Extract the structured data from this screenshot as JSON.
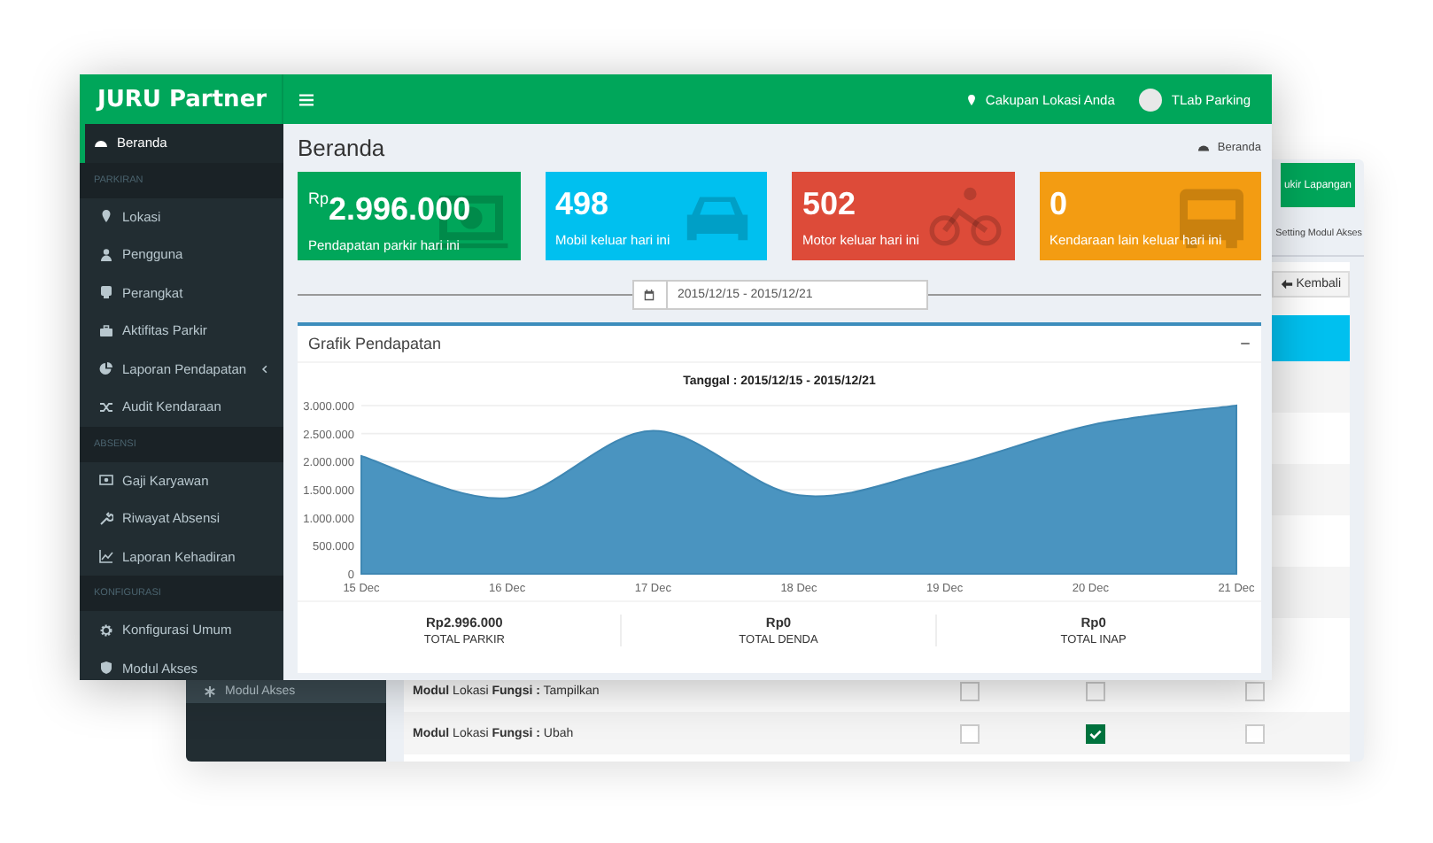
{
  "back_window": {
    "header_button": "ukir Lapangan",
    "breadcrumb": "Setting Modul Akses",
    "back_button": "Kembali",
    "sidebar_item": {
      "label": "Modul Akses",
      "selected": true
    },
    "permission_rows": [
      {
        "label": "**Modul** Lokasi **Fungsi :** Tampilkan",
        "checks": [
          {
            "checked": false
          },
          {
            "checked": false
          },
          {
            "checked": false
          }
        ]
      },
      {
        "label": "**Modul** Lokasi **Fungsi :** Ubah",
        "checks": [
          {
            "checked": false
          },
          {
            "checked": true
          },
          {
            "checked": false
          }
        ]
      }
    ]
  },
  "front_window": {
    "brand": "JURU Partner",
    "header": {
      "location": "Cakupan Lokasi Anda",
      "user": "TLab Parking"
    },
    "sidebar": [
      {
        "kind": "item",
        "label": "Beranda",
        "selected": true
      },
      {
        "kind": "header",
        "label": "PARKIRAN"
      },
      {
        "kind": "item",
        "label": "Lokasi",
        "selected": false
      },
      {
        "kind": "item",
        "label": "Pengguna",
        "selected": false
      },
      {
        "kind": "item",
        "label": "Perangkat",
        "selected": false
      },
      {
        "kind": "item",
        "label": "Aktifitas Parkir",
        "selected": false
      },
      {
        "kind": "item",
        "label": "Laporan Pendapatan",
        "selected": false,
        "expanded": false
      },
      {
        "kind": "item",
        "label": "Audit Kendaraan",
        "selected": false
      },
      {
        "kind": "header",
        "label": "ABSENSI"
      },
      {
        "kind": "item",
        "label": "Gaji Karyawan",
        "selected": false
      },
      {
        "kind": "item",
        "label": "Riwayat Absensi",
        "selected": false
      },
      {
        "kind": "item",
        "label": "Laporan Kehadiran",
        "selected": false
      },
      {
        "kind": "header",
        "label": "KONFIGURASI"
      },
      {
        "kind": "item",
        "label": "Konfigurasi Umum",
        "selected": false
      },
      {
        "kind": "item",
        "label": "Modul Akses",
        "selected": false
      }
    ],
    "page_title": "Beranda",
    "breadcrumb": "Beranda",
    "stat_cards": [
      {
        "value": "$^{Rp}$2.996.000",
        "label": "Pendapatan parkir hari ini",
        "color": "#00a65a"
      },
      {
        "value": "498",
        "label": "Mobil keluar hari ini",
        "color": "#00c0ef"
      },
      {
        "value": "502",
        "label": "Motor keluar hari ini",
        "color": "#dd4b39"
      },
      {
        "value": "0",
        "label": "Kendaraan lain keluar hari ini",
        "color": "#f39c12"
      }
    ],
    "date_range": "2015/12/15 - 2015/12/21",
    "chart_panel": {
      "title": "Grafik Pendapatan",
      "chart_data": {
        "type": "area",
        "title": "Tanggal : 2015/12/15 - 2015/12/21",
        "categories": [
          "15 Dec",
          "16 Dec",
          "17 Dec",
          "18 Dec",
          "19 Dec",
          "20 Dec",
          "21 Dec"
        ],
        "values": [
          2100000,
          1350000,
          2550000,
          1400000,
          1900000,
          2650000,
          3000000
        ],
        "ylim": [
          0,
          3000000
        ],
        "grid": true,
        "yticks": [
          {
            "value": 0,
            "label": "0"
          },
          {
            "value": 500000,
            "label": "500.000"
          },
          {
            "value": 1000000,
            "label": "1.000.000"
          },
          {
            "value": 1500000,
            "label": "1.500.000"
          },
          {
            "value": 2000000,
            "label": "2.000.000"
          },
          {
            "value": 2500000,
            "label": "2.500.000"
          },
          {
            "value": 3000000,
            "label": "3.000.000"
          }
        ]
      },
      "totals": [
        {
          "value": "Rp2.996.000",
          "label": "TOTAL PARKIR"
        },
        {
          "value": "Rp0",
          "label": "TOTAL DENDA"
        },
        {
          "value": "Rp0",
          "label": "TOTAL INAP"
        }
      ]
    }
  }
}
